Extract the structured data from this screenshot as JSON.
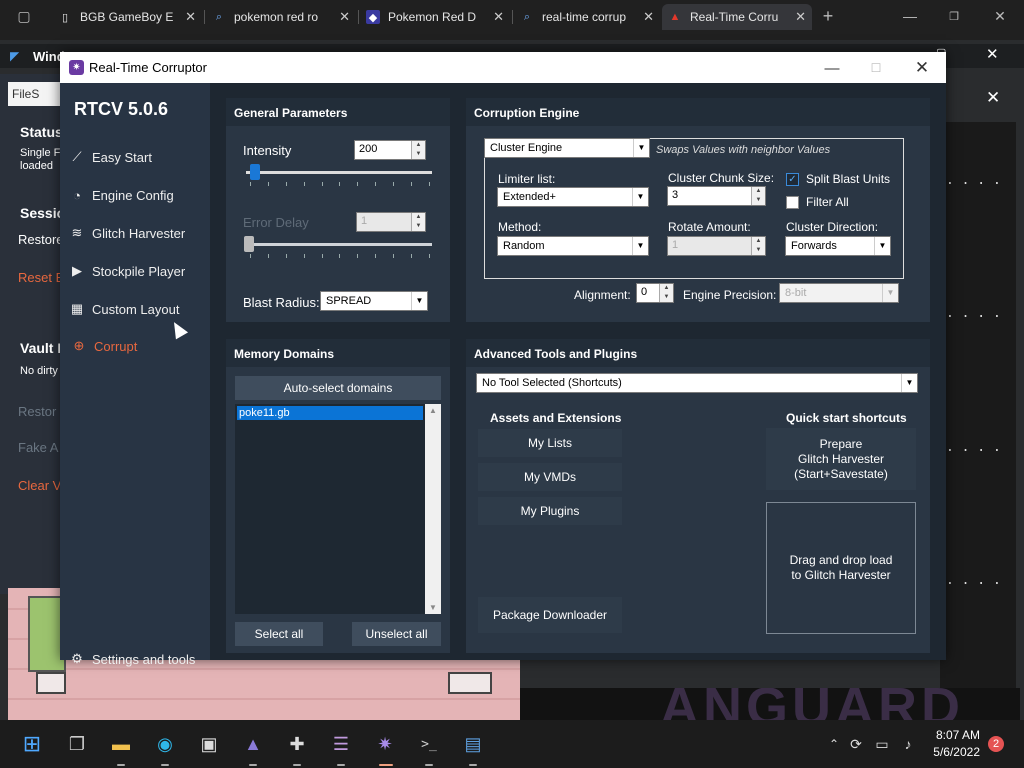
{
  "browser": {
    "tabs": [
      {
        "title": "BGB GameBoy E",
        "icon": "page-icon"
      },
      {
        "title": "pokemon red ro",
        "icon": "search-icon"
      },
      {
        "title": "Pokemon Red D",
        "icon": "site-icon"
      },
      {
        "title": "real-time corrup",
        "icon": "search-icon"
      },
      {
        "title": "Real-Time Corru",
        "icon": "rtc-icon"
      }
    ],
    "new_tab": "+"
  },
  "background": {
    "window_title": "Wind",
    "fileshare": "FileS",
    "status": "Status",
    "single": "Single F",
    "loaded": "loaded",
    "session": "Sessio",
    "restore": "Restore",
    "reset": "Reset B",
    "vault": "Vault D",
    "no_dirty": "No dirty",
    "restor2": "Restor",
    "fake": "Fake A",
    "clear": "Clear V",
    "dots": ". . . ."
  },
  "rtc": {
    "title": "Real-Time Corruptor",
    "version": "RTCV 5.0.6",
    "sidebar": [
      {
        "label": "Easy Start",
        "icon": "wand-icon"
      },
      {
        "label": "Engine Config",
        "icon": "gauge-icon"
      },
      {
        "label": "Glitch Harvester",
        "icon": "layers-icon"
      },
      {
        "label": "Stockpile Player",
        "icon": "play-icon"
      },
      {
        "label": "Custom Layout",
        "icon": "grid-icon"
      },
      {
        "label": "Corrupt",
        "icon": "crosshair-icon"
      }
    ],
    "settings": "Settings and tools",
    "general": {
      "header": "General Parameters",
      "intensity_label": "Intensity",
      "intensity_value": "200",
      "intensity_level": 0.02,
      "error_delay_label": "Error Delay",
      "error_delay_value": "1",
      "blast_radius_label": "Blast Radius:",
      "blast_radius_value": "SPREAD"
    },
    "engine": {
      "header": "Corruption Engine",
      "engine_select": "Cluster Engine",
      "engine_desc": "Swaps Values with neighbor Values",
      "limiter_label": "Limiter list:",
      "limiter_value": "Extended+",
      "chunk_label": "Cluster Chunk Size:",
      "chunk_value": "3",
      "split_blast": "Split Blast Units",
      "filter_all": "Filter All",
      "method_label": "Method:",
      "method_value": "Random",
      "rotate_label": "Rotate Amount:",
      "rotate_value": "1",
      "direction_label": "Cluster Direction:",
      "direction_value": "Forwards",
      "alignment_label": "Alignment:",
      "alignment_value": "0",
      "precision_label": "Engine Precision:",
      "precision_value": "8-bit"
    },
    "memory": {
      "header": "Memory Domains",
      "auto_select": "Auto-select domains",
      "domains": [
        "poke11.gb"
      ],
      "select_all": "Select all",
      "unselect_all": "Unselect all"
    },
    "advanced": {
      "header": "Advanced Tools and Plugins",
      "tool_select": "No Tool Selected (Shortcuts)",
      "assets_header": "Assets and Extensions",
      "my_lists": "My Lists",
      "my_vmds": "My VMDs",
      "my_plugins": "My Plugins",
      "package_downloader": "Package Downloader",
      "quick_header": "Quick start shortcuts",
      "prepare": "Prepare\nGlitch Harvester\n(Start+Savestate)",
      "drag_drop": "Drag and drop load\nto Glitch Harvester"
    }
  },
  "taskbar": {
    "time": "8:07 AM",
    "date": "5/6/2022",
    "notifications": "2"
  }
}
